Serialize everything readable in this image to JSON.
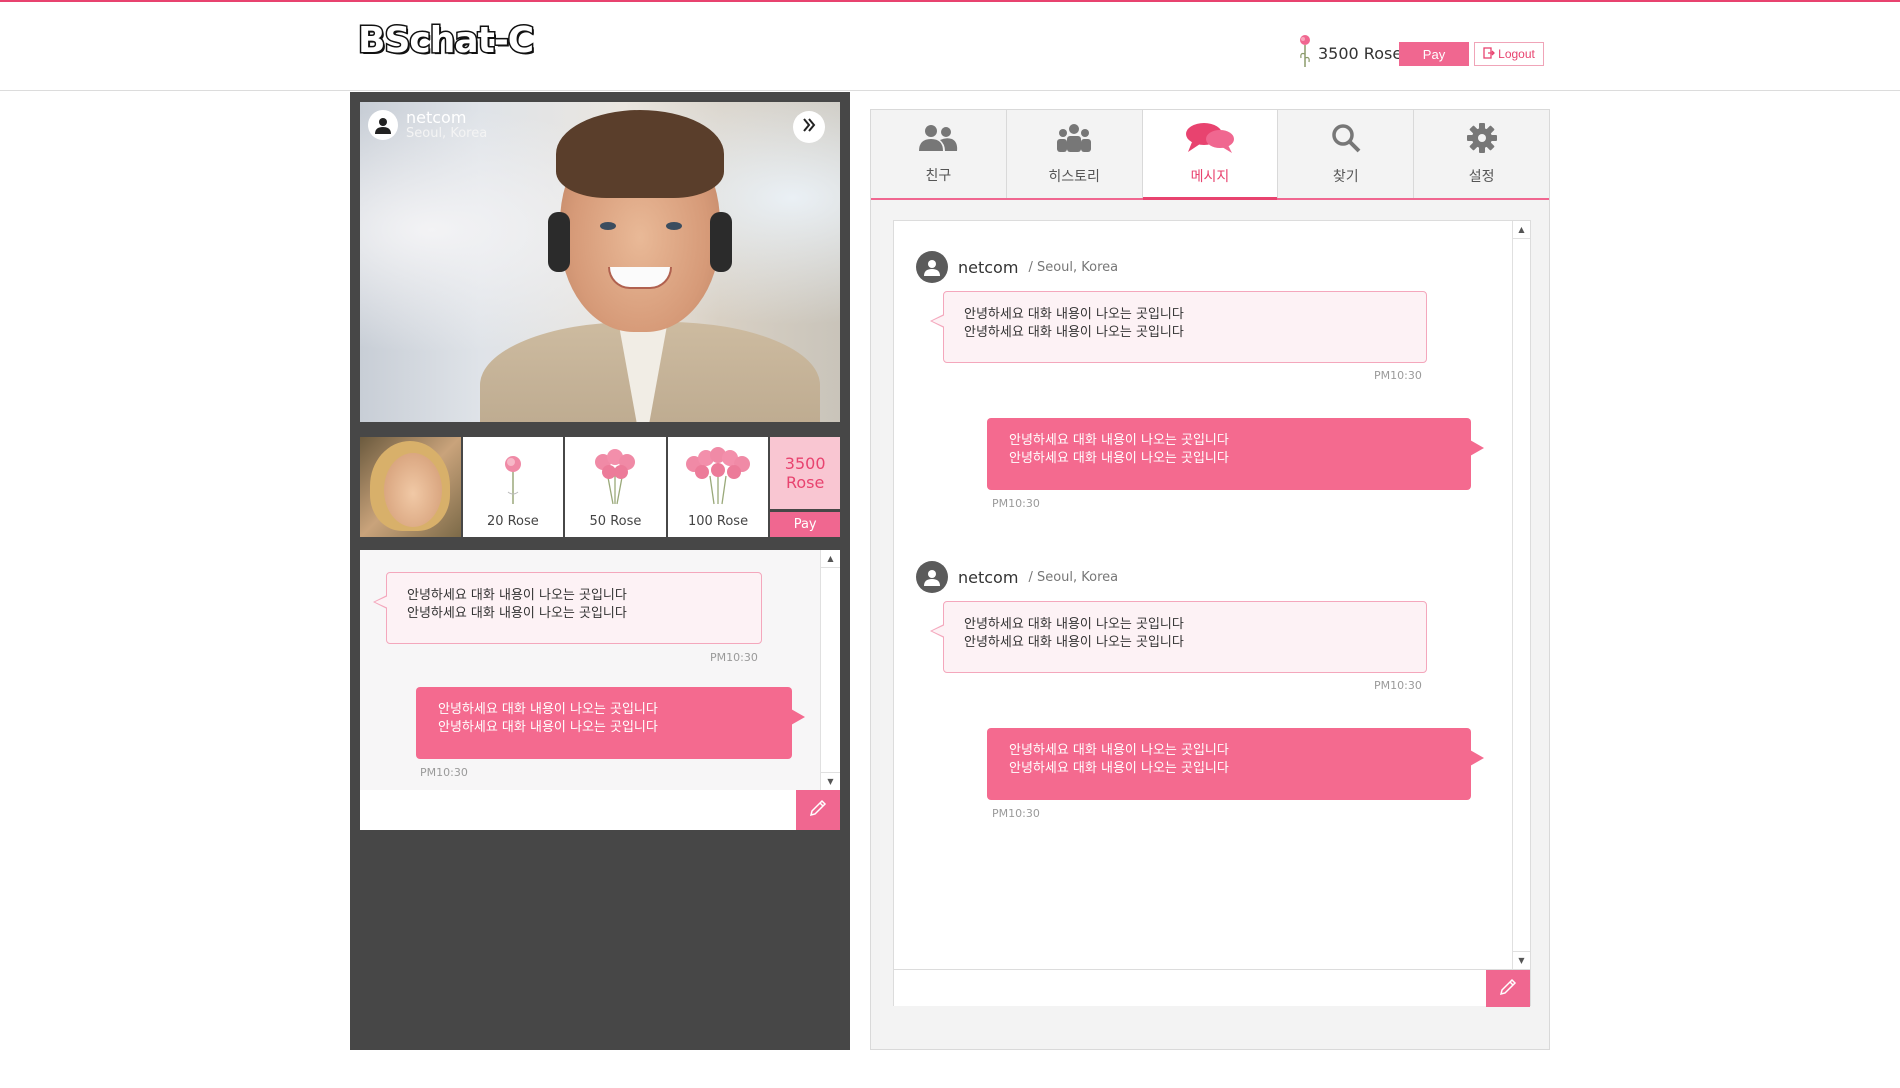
{
  "app": {
    "logo": "BSchat-C",
    "accent": "#e8436f",
    "accent_fill": "#f06790"
  },
  "header": {
    "rose_icon": "rose-icon",
    "rose_balance": "3500 Rose",
    "pay_label": "Pay",
    "logout_label": "Logout",
    "logout_icon": "logout-icon"
  },
  "video": {
    "user_name": "netcom",
    "user_location": "Seoul, Korea",
    "expand_icon": "double-chevron-right-icon"
  },
  "gifts": {
    "items": [
      {
        "label": "20 Rose",
        "icon": "rose-bouquet-small-icon"
      },
      {
        "label": "50 Rose",
        "icon": "rose-bouquet-medium-icon"
      },
      {
        "label": "100 Rose",
        "icon": "rose-bouquet-large-icon"
      }
    ],
    "balance_line1": "3500",
    "balance_line2": "Rose",
    "pay_label": "Pay"
  },
  "mini_chat": {
    "incoming": {
      "line1": "안녕하세요 대화 내용이 나오는 곳입니다",
      "line2": "안녕하세요 대화 내용이 나오는 곳입니다",
      "time": "PM10:30"
    },
    "outgoing": {
      "line1": "안녕하세요 대화 내용이 나오는 곳입니다",
      "line2": "안녕하세요 대화 내용이 나오는 곳입니다",
      "time": "PM10:30"
    },
    "input_placeholder": "",
    "send_icon": "pencil-icon"
  },
  "tabs": [
    {
      "label": "친구",
      "icon": "friends-icon",
      "active": false
    },
    {
      "label": "히스토리",
      "icon": "group-history-icon",
      "active": false
    },
    {
      "label": "메시지",
      "icon": "chat-bubbles-icon",
      "active": true
    },
    {
      "label": "찾기",
      "icon": "search-icon",
      "active": false
    },
    {
      "label": "설정",
      "icon": "gear-icon",
      "active": false
    }
  ],
  "messages": {
    "thread": [
      {
        "sender_name": "netcom",
        "sender_location": "/ Seoul, Korea",
        "incoming": {
          "line1": "안녕하세요 대화 내용이 나오는 곳입니다",
          "line2": "안녕하세요 대화 내용이 나오는 곳입니다",
          "time": "PM10:30"
        },
        "outgoing": {
          "line1": "안녕하세요 대화 내용이 나오는 곳입니다",
          "line2": "안녕하세요 대화 내용이 나오는 곳입니다",
          "time": "PM10:30"
        }
      },
      {
        "sender_name": "netcom",
        "sender_location": "/ Seoul, Korea",
        "incoming": {
          "line1": "안녕하세요 대화 내용이 나오는 곳입니다",
          "line2": "안녕하세요 대화 내용이 나오는 곳입니다",
          "time": "PM10:30"
        },
        "outgoing": {
          "line1": "안녕하세요 대화 내용이 나오는 곳입니다",
          "line2": "안녕하세요 대화 내용이 나오는 곳입니다",
          "time": "PM10:30"
        }
      }
    ],
    "input_placeholder": "",
    "send_icon": "pencil-icon"
  }
}
